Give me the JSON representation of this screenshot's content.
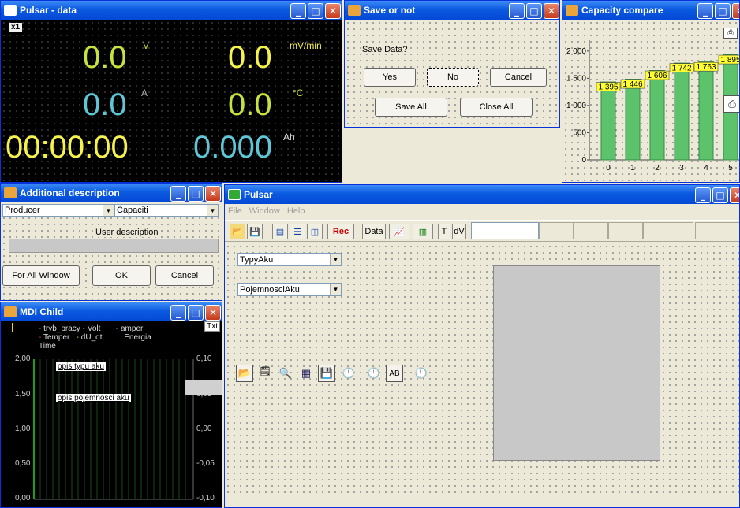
{
  "win_data": {
    "title": "Pulsar - data",
    "corner": "x1",
    "volt": "0.0",
    "volt_unit": "V",
    "rate": "0.0",
    "rate_unit": "mV/min",
    "amp": "0.0",
    "amp_unit": "A",
    "temp": "0.0",
    "temp_unit": "°C",
    "time": "00:00:00",
    "ah": "0.000",
    "ah_unit": "Ah"
  },
  "win_save": {
    "title": "Save or not",
    "prompt": "Save Data?",
    "yes": "Yes",
    "no": "No",
    "cancel": "Cancel",
    "save_all": "Save All",
    "close_all": "Close All"
  },
  "win_cap": {
    "title": "Capacity compare",
    "chart_data": {
      "type": "bar",
      "categories": [
        "0",
        "1",
        "2",
        "3",
        "4",
        "5"
      ],
      "values": [
        1395,
        1446,
        1606,
        1742,
        1763,
        1895
      ],
      "yticks": [
        "2 000",
        "1 500",
        "1 000",
        "500",
        "0"
      ],
      "ylim": [
        0,
        2200
      ]
    }
  },
  "win_add": {
    "title": "Additional description",
    "producer": "Producer",
    "capacity": "Capaciti",
    "user_desc": "User description",
    "for_all": "For All Window",
    "ok": "OK",
    "cancel": "Cancel"
  },
  "win_mdi": {
    "title": "MDI Child",
    "txt": "Txt",
    "legend": [
      "tryb_pracy",
      "Volt",
      "amper",
      "Temper",
      "dU_dt",
      "Energia",
      "Time"
    ],
    "box1": "opis typu aku",
    "box2": "opis pojemnosci aku",
    "left_ticks": [
      "2,00",
      "1,50",
      "1,00",
      "0,50",
      "0,00"
    ],
    "right_ticks": [
      "0,10",
      "0,05",
      "0,00",
      "-0,05",
      "-0,10"
    ]
  },
  "win_pulsar": {
    "title": "Pulsar",
    "menu": [
      "File",
      "Window",
      "Help"
    ],
    "rec": "Rec",
    "data": "Data",
    "t": "T",
    "dv": "dV",
    "combo1": "TypyAku",
    "combo2": "PojemnosciAku"
  }
}
